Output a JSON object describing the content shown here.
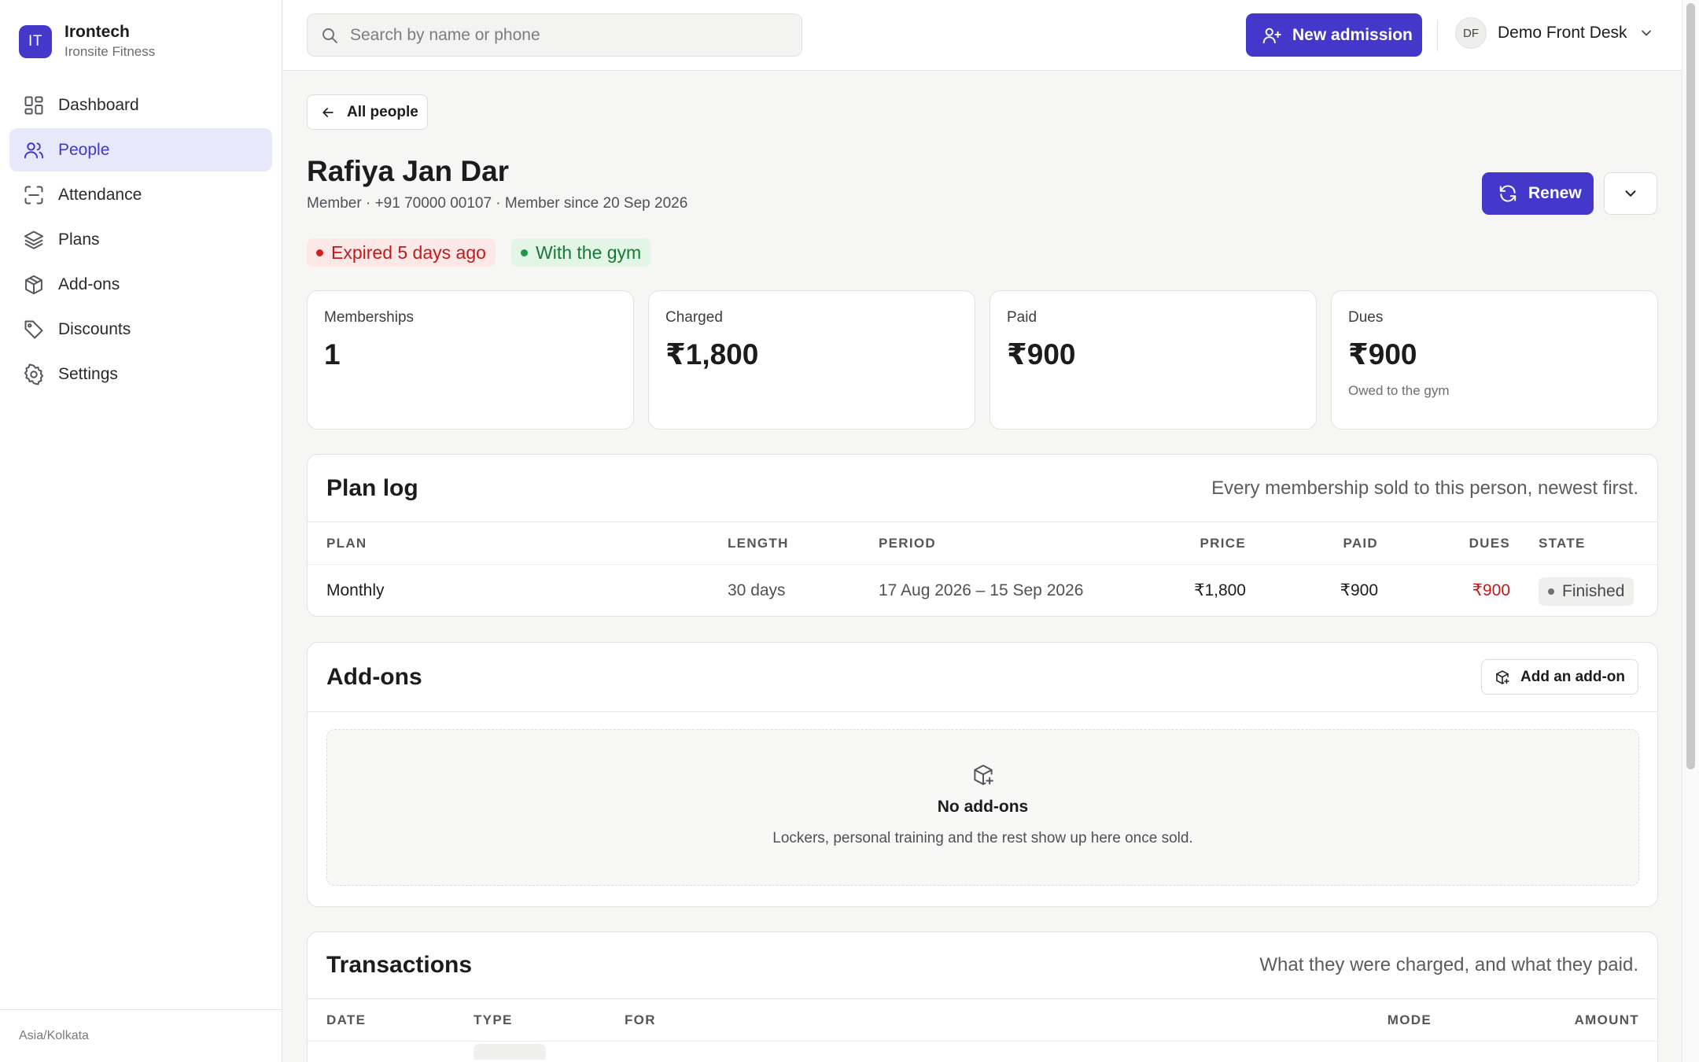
{
  "sidebar": {
    "brand_initials": "IT",
    "brand_name": "Irontech",
    "brand_sub": "Ironsite Fitness",
    "items": [
      {
        "label": "Dashboard",
        "icon": "dashboard-icon"
      },
      {
        "label": "People",
        "icon": "users-icon",
        "active": true
      },
      {
        "label": "Attendance",
        "icon": "scan-icon"
      },
      {
        "label": "Plans",
        "icon": "layers-icon"
      },
      {
        "label": "Add-ons",
        "icon": "package-icon"
      },
      {
        "label": "Discounts",
        "icon": "tag-icon"
      },
      {
        "label": "Settings",
        "icon": "gear-icon"
      }
    ],
    "timezone": "Asia/Kolkata"
  },
  "topbar": {
    "search_placeholder": "Search by name or phone",
    "new_admission_label": "New admission",
    "user_initials": "DF",
    "user_name": "Demo Front Desk"
  },
  "back_label": "All people",
  "person": {
    "name": "Rafiya Jan Dar",
    "meta": "Member · +91 70000 00107 · Member since 20 Sep 2026",
    "renew_label": "Renew",
    "badges": {
      "expired": "Expired 5 days ago",
      "presence": "With the gym"
    }
  },
  "stats": [
    {
      "label": "Memberships",
      "value": "1"
    },
    {
      "label": "Charged",
      "value": "₹1,800"
    },
    {
      "label": "Paid",
      "value": "₹900"
    },
    {
      "label": "Dues",
      "value": "₹900",
      "sub": "Owed to the gym"
    }
  ],
  "plan_log": {
    "title": "Plan log",
    "description": "Every membership sold to this person, newest first.",
    "columns": {
      "plan": "PLAN",
      "length": "LENGTH",
      "period": "PERIOD",
      "price": "PRICE",
      "paid": "PAID",
      "dues": "DUES",
      "state": "STATE"
    },
    "rows": [
      {
        "plan": "Monthly",
        "length": "30 days",
        "period": "17 Aug 2026 – 15 Sep 2026",
        "price": "₹1,800",
        "paid": "₹900",
        "dues": "₹900",
        "state": "Finished"
      }
    ]
  },
  "addons": {
    "title": "Add-ons",
    "add_label": "Add an add-on",
    "empty_title": "No add-ons",
    "empty_desc": "Lockers, personal training and the rest show up here once sold."
  },
  "transactions": {
    "title": "Transactions",
    "description": "What they were charged, and what they paid.",
    "columns": {
      "date": "DATE",
      "type": "TYPE",
      "for": "FOR",
      "mode": "MODE",
      "amount": "AMOUNT"
    }
  },
  "colors": {
    "accent": "#4338ca",
    "danger": "#c21a1a",
    "success": "#167a35"
  }
}
